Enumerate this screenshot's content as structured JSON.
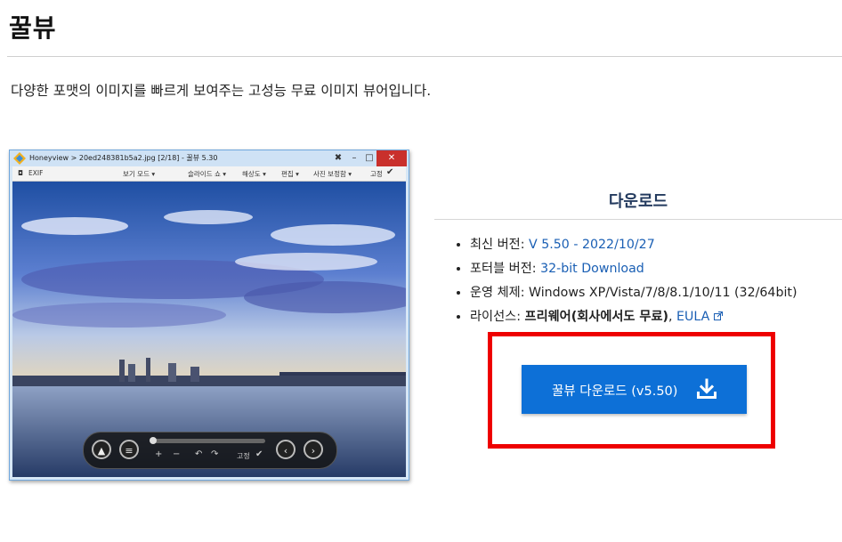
{
  "page": {
    "title": "꿀뷰",
    "description": "다양한 포맷의 이미지를 빠르게 보여주는 고성능 무료 이미지 뷰어입니다."
  },
  "screenshot": {
    "window_title": "Honeyview > 20ed248381b5a2.jpg [2/18] - 꿀뷰 5.30",
    "toolbar": {
      "exif": "EXIF",
      "view_mode": "보기 모드 ▾",
      "slideshow": "슬라이드 쇼 ▾",
      "resolution": "해상도 ▾",
      "edit": "편집 ▾",
      "photo_correction": "사진 보정함 ▾",
      "fix": "고정"
    },
    "controls": {
      "fix_label": "고정"
    }
  },
  "download": {
    "heading": "다운로드",
    "latest_label": "최신 버전: ",
    "latest_value": "V 5.50 - 2022/10/27",
    "portable_label": "포터블 버전: ",
    "portable_value": "32-bit Download",
    "os_label": "운영 체제: ",
    "os_value": "Windows XP/Vista/7/8/8.1/10/11 (32/64bit)",
    "license_label": "라이선스: ",
    "license_value": "프리웨어(회사에서도 무료)",
    "license_sep": ", ",
    "eula": "EULA",
    "button_label": "꿀뷰 다운로드 (v5.50)"
  },
  "icons": {
    "app": "honeyview-app-icon",
    "download": "download-arrow-icon",
    "external": "external-link-icon"
  },
  "colors": {
    "button": "#0d70d7",
    "highlight": "#ee0000",
    "link": "#1a5fb4"
  }
}
